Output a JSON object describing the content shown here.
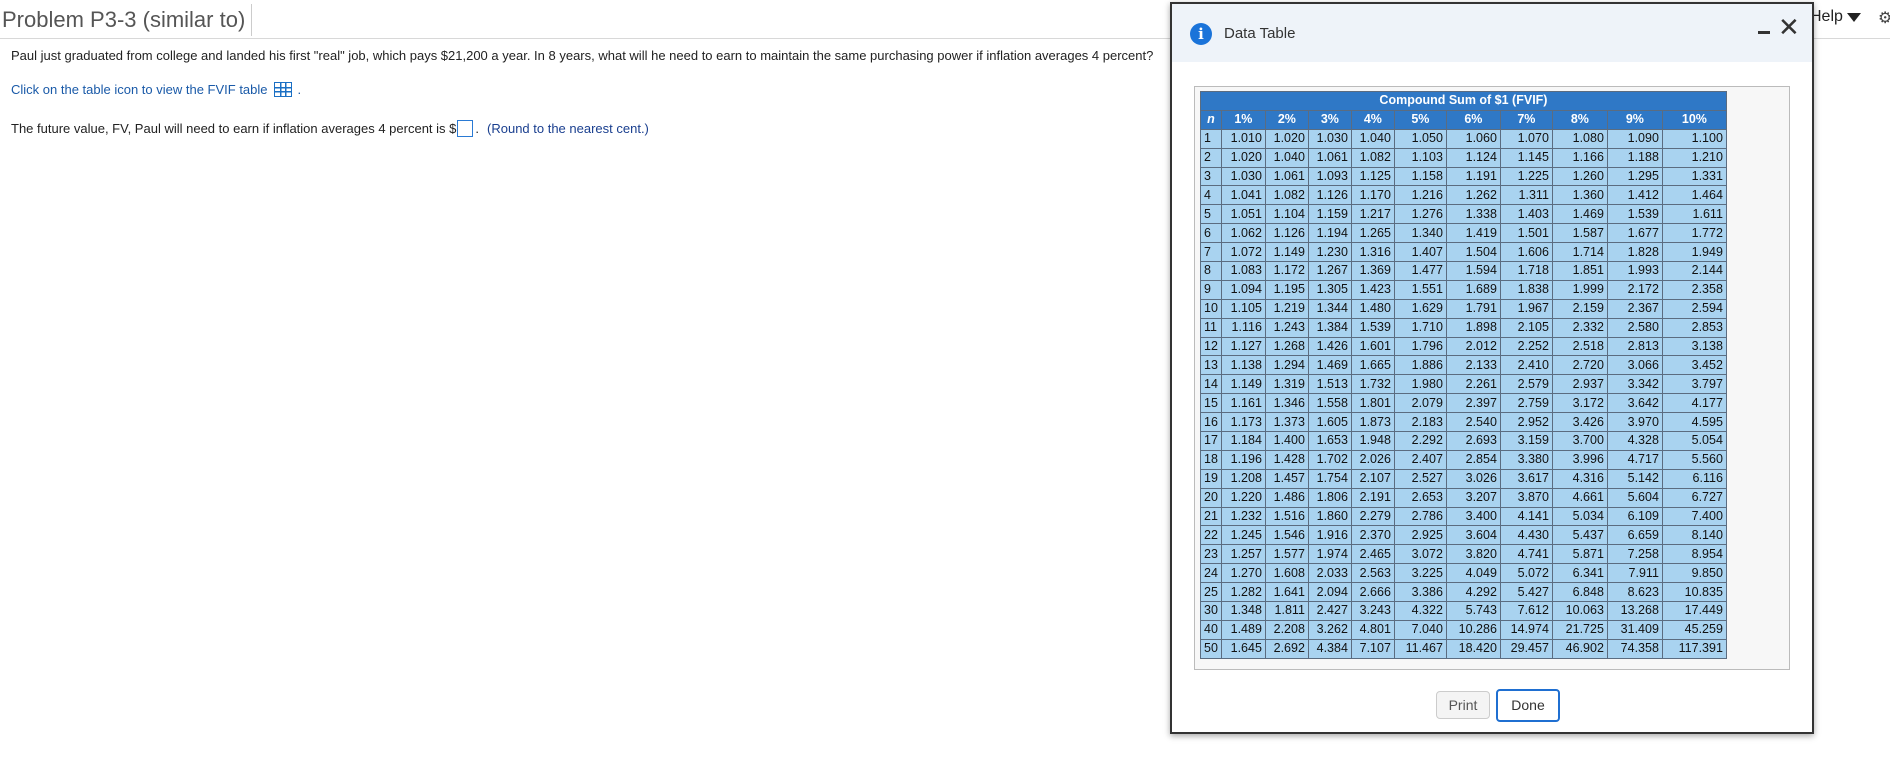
{
  "page": {
    "title": "Problem P3-3 (similar to)",
    "question": "Paul just graduated from college and landed his first \"real\" job, which pays $21,200 a year. In 8 years, what will he need to earn to maintain the same purchasing power if inflation averages 4 percent?",
    "table_link": "Click on the table icon to view the FVIF table",
    "answer_prefix": "The future value, FV, Paul will need to earn if inflation averages 4 percent is $",
    "answer_value": "",
    "answer_suffix": ".",
    "round_note": "(Round to the nearest cent.)",
    "help_label": "Help"
  },
  "modal": {
    "title": "Data Table",
    "print_label": "Print",
    "done_label": "Done"
  },
  "fvif_table": {
    "caption": "Compound Sum of $1 (FVIF)",
    "headers": [
      "n",
      "1%",
      "2%",
      "3%",
      "4%",
      "5%",
      "6%",
      "7%",
      "8%",
      "9%",
      "10%"
    ],
    "rows": [
      [
        "1",
        "1.010",
        "1.020",
        "1.030",
        "1.040",
        "1.050",
        "1.060",
        "1.070",
        "1.080",
        "1.090",
        "1.100"
      ],
      [
        "2",
        "1.020",
        "1.040",
        "1.061",
        "1.082",
        "1.103",
        "1.124",
        "1.145",
        "1.166",
        "1.188",
        "1.210"
      ],
      [
        "3",
        "1.030",
        "1.061",
        "1.093",
        "1.125",
        "1.158",
        "1.191",
        "1.225",
        "1.260",
        "1.295",
        "1.331"
      ],
      [
        "4",
        "1.041",
        "1.082",
        "1.126",
        "1.170",
        "1.216",
        "1.262",
        "1.311",
        "1.360",
        "1.412",
        "1.464"
      ],
      [
        "5",
        "1.051",
        "1.104",
        "1.159",
        "1.217",
        "1.276",
        "1.338",
        "1.403",
        "1.469",
        "1.539",
        "1.611"
      ],
      [
        "6",
        "1.062",
        "1.126",
        "1.194",
        "1.265",
        "1.340",
        "1.419",
        "1.501",
        "1.587",
        "1.677",
        "1.772"
      ],
      [
        "7",
        "1.072",
        "1.149",
        "1.230",
        "1.316",
        "1.407",
        "1.504",
        "1.606",
        "1.714",
        "1.828",
        "1.949"
      ],
      [
        "8",
        "1.083",
        "1.172",
        "1.267",
        "1.369",
        "1.477",
        "1.594",
        "1.718",
        "1.851",
        "1.993",
        "2.144"
      ],
      [
        "9",
        "1.094",
        "1.195",
        "1.305",
        "1.423",
        "1.551",
        "1.689",
        "1.838",
        "1.999",
        "2.172",
        "2.358"
      ],
      [
        "10",
        "1.105",
        "1.219",
        "1.344",
        "1.480",
        "1.629",
        "1.791",
        "1.967",
        "2.159",
        "2.367",
        "2.594"
      ],
      [
        "11",
        "1.116",
        "1.243",
        "1.384",
        "1.539",
        "1.710",
        "1.898",
        "2.105",
        "2.332",
        "2.580",
        "2.853"
      ],
      [
        "12",
        "1.127",
        "1.268",
        "1.426",
        "1.601",
        "1.796",
        "2.012",
        "2.252",
        "2.518",
        "2.813",
        "3.138"
      ],
      [
        "13",
        "1.138",
        "1.294",
        "1.469",
        "1.665",
        "1.886",
        "2.133",
        "2.410",
        "2.720",
        "3.066",
        "3.452"
      ],
      [
        "14",
        "1.149",
        "1.319",
        "1.513",
        "1.732",
        "1.980",
        "2.261",
        "2.579",
        "2.937",
        "3.342",
        "3.797"
      ],
      [
        "15",
        "1.161",
        "1.346",
        "1.558",
        "1.801",
        "2.079",
        "2.397",
        "2.759",
        "3.172",
        "3.642",
        "4.177"
      ],
      [
        "16",
        "1.173",
        "1.373",
        "1.605",
        "1.873",
        "2.183",
        "2.540",
        "2.952",
        "3.426",
        "3.970",
        "4.595"
      ],
      [
        "17",
        "1.184",
        "1.400",
        "1.653",
        "1.948",
        "2.292",
        "2.693",
        "3.159",
        "3.700",
        "4.328",
        "5.054"
      ],
      [
        "18",
        "1.196",
        "1.428",
        "1.702",
        "2.026",
        "2.407",
        "2.854",
        "3.380",
        "3.996",
        "4.717",
        "5.560"
      ],
      [
        "19",
        "1.208",
        "1.457",
        "1.754",
        "2.107",
        "2.527",
        "3.026",
        "3.617",
        "4.316",
        "5.142",
        "6.116"
      ],
      [
        "20",
        "1.220",
        "1.486",
        "1.806",
        "2.191",
        "2.653",
        "3.207",
        "3.870",
        "4.661",
        "5.604",
        "6.727"
      ],
      [
        "21",
        "1.232",
        "1.516",
        "1.860",
        "2.279",
        "2.786",
        "3.400",
        "4.141",
        "5.034",
        "6.109",
        "7.400"
      ],
      [
        "22",
        "1.245",
        "1.546",
        "1.916",
        "2.370",
        "2.925",
        "3.604",
        "4.430",
        "5.437",
        "6.659",
        "8.140"
      ],
      [
        "23",
        "1.257",
        "1.577",
        "1.974",
        "2.465",
        "3.072",
        "3.820",
        "4.741",
        "5.871",
        "7.258",
        "8.954"
      ],
      [
        "24",
        "1.270",
        "1.608",
        "2.033",
        "2.563",
        "3.225",
        "4.049",
        "5.072",
        "6.341",
        "7.911",
        "9.850"
      ],
      [
        "25",
        "1.282",
        "1.641",
        "2.094",
        "2.666",
        "3.386",
        "4.292",
        "5.427",
        "6.848",
        "8.623",
        "10.835"
      ],
      [
        "30",
        "1.348",
        "1.811",
        "2.427",
        "3.243",
        "4.322",
        "5.743",
        "7.612",
        "10.063",
        "13.268",
        "17.449"
      ],
      [
        "40",
        "1.489",
        "2.208",
        "3.262",
        "4.801",
        "7.040",
        "10.286",
        "14.974",
        "21.725",
        "31.409",
        "45.259"
      ],
      [
        "50",
        "1.645",
        "2.692",
        "4.384",
        "7.107",
        "11.467",
        "18.420",
        "29.457",
        "46.902",
        "74.358",
        "117.391"
      ]
    ]
  },
  "icons": {
    "info": "info-icon",
    "minimize": "minimize-icon",
    "close": "close-icon",
    "table": "table-icon",
    "help_caret": "caret-down-icon",
    "gear": "gear-icon"
  },
  "colors": {
    "header_blue": "#2f78c6",
    "cell_blue": "#a9d3f0",
    "link_blue": "#1a5aa8",
    "done_border": "#1f6fd1"
  }
}
